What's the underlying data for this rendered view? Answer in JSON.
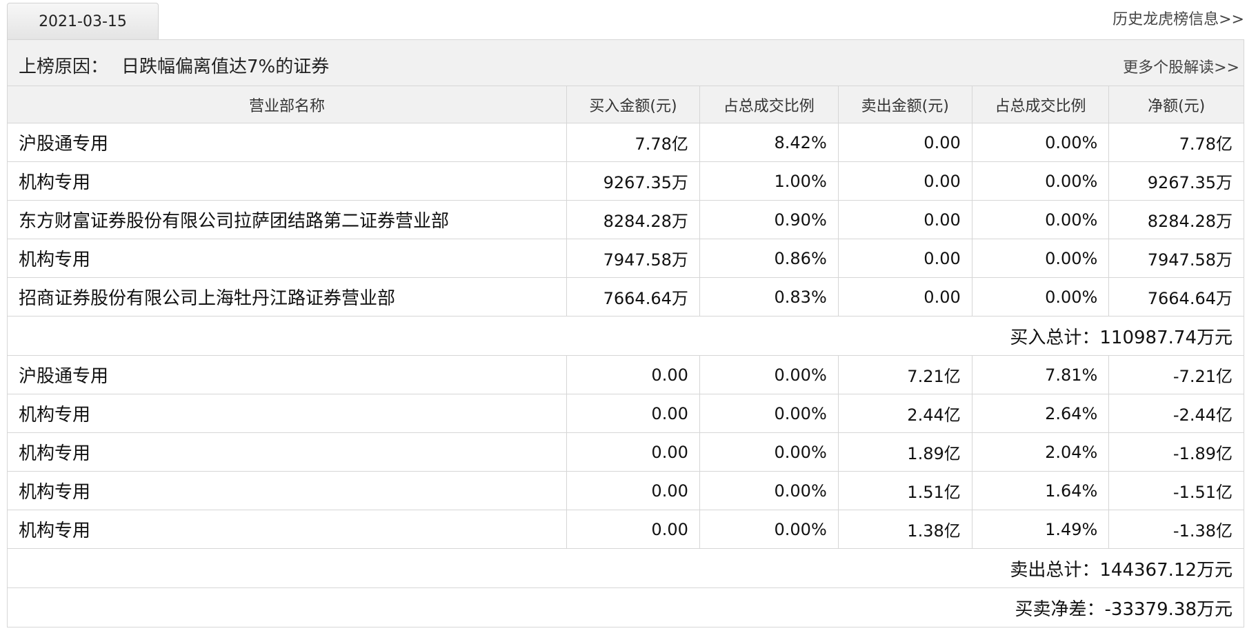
{
  "header": {
    "date": "2021-03-15",
    "history_link": "历史龙虎榜信息>>"
  },
  "reason": {
    "label": "上榜原因：",
    "text": "日跌幅偏离值达7%的证券",
    "more_link": "更多个股解读>>"
  },
  "table": {
    "columns": [
      "营业部名称",
      "买入金额(元)",
      "占总成交比例",
      "卖出金额(元)",
      "占总成交比例",
      "净额(元)"
    ],
    "buy_rows": [
      {
        "name": "沪股通专用",
        "buy": "7.78亿",
        "buy_pct": "8.42%",
        "sell": "0.00",
        "sell_pct": "0.00%",
        "net": "7.78亿"
      },
      {
        "name": "机构专用",
        "buy": "9267.35万",
        "buy_pct": "1.00%",
        "sell": "0.00",
        "sell_pct": "0.00%",
        "net": "9267.35万"
      },
      {
        "name": "东方财富证券股份有限公司拉萨团结路第二证券营业部",
        "buy": "8284.28万",
        "buy_pct": "0.90%",
        "sell": "0.00",
        "sell_pct": "0.00%",
        "net": "8284.28万"
      },
      {
        "name": "机构专用",
        "buy": "7947.58万",
        "buy_pct": "0.86%",
        "sell": "0.00",
        "sell_pct": "0.00%",
        "net": "7947.58万"
      },
      {
        "name": "招商证券股份有限公司上海牡丹江路证券营业部",
        "buy": "7664.64万",
        "buy_pct": "0.83%",
        "sell": "0.00",
        "sell_pct": "0.00%",
        "net": "7664.64万"
      }
    ],
    "buy_total": "买入总计：110987.74万元",
    "sell_rows": [
      {
        "name": "沪股通专用",
        "buy": "0.00",
        "buy_pct": "0.00%",
        "sell": "7.21亿",
        "sell_pct": "7.81%",
        "net": "-7.21亿"
      },
      {
        "name": "机构专用",
        "buy": "0.00",
        "buy_pct": "0.00%",
        "sell": "2.44亿",
        "sell_pct": "2.64%",
        "net": "-2.44亿"
      },
      {
        "name": "机构专用",
        "buy": "0.00",
        "buy_pct": "0.00%",
        "sell": "1.89亿",
        "sell_pct": "2.04%",
        "net": "-1.89亿"
      },
      {
        "name": "机构专用",
        "buy": "0.00",
        "buy_pct": "0.00%",
        "sell": "1.51亿",
        "sell_pct": "1.64%",
        "net": "-1.51亿"
      },
      {
        "name": "机构专用",
        "buy": "0.00",
        "buy_pct": "0.00%",
        "sell": "1.38亿",
        "sell_pct": "1.49%",
        "net": "-1.38亿"
      }
    ],
    "sell_total": "卖出总计：144367.12万元",
    "net_total": "买卖净差：-33379.38万元"
  }
}
